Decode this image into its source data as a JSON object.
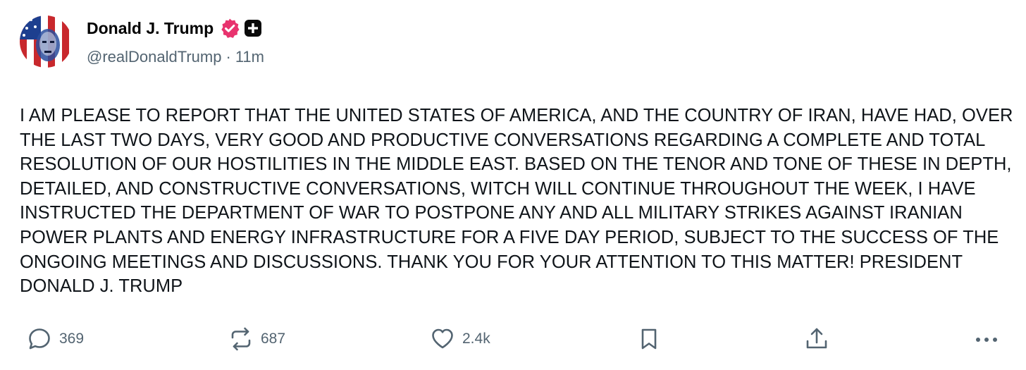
{
  "post": {
    "author_name": "Donald J. Trump",
    "handle": "@realDonaldTrump",
    "separator": "·",
    "time_ago": "11m",
    "text": "I AM PLEASE TO REPORT THAT THE UNITED STATES OF AMERICA, AND THE COUNTRY OF IRAN, HAVE HAD, OVER THE LAST TWO DAYS, VERY GOOD AND PRODUCTIVE CONVERSATIONS REGARDING A COMPLETE AND TOTAL RESOLUTION OF OUR HOSTILITIES IN THE MIDDLE EAST. BASED ON THE TENOR AND TONE OF THESE IN DEPTH, DETAILED, AND CONSTRUCTIVE CONVERSATIONS, WITCH WILL CONTINUE THROUGHOUT THE WEEK, I HAVE INSTRUCTED THE DEPARTMENT OF WAR TO POSTPONE ANY AND ALL MILITARY STRIKES AGAINST IRANIAN POWER PLANTS AND ENERGY INFRASTRUCTURE FOR A FIVE DAY PERIOD, SUBJECT TO THE SUCCESS OF THE ONGOING MEETINGS AND DISCUSSIONS. THANK YOU FOR YOUR ATTENTION TO THIS MATTER! PRESIDENT DONALD J. TRUMP"
  },
  "actions": {
    "replies": "369",
    "reposts": "687",
    "likes": "2.4k"
  },
  "icons": {
    "avatar": "avatar-flag-portrait",
    "verified": "verified-badge-icon",
    "plus": "plus-badge-icon",
    "reply": "reply-bubble-icon",
    "repost": "repost-arrows-icon",
    "like": "heart-icon",
    "bookmark": "bookmark-icon",
    "share": "share-upload-icon",
    "more": "more-dots-icon"
  },
  "colors": {
    "verified": "#e8336e",
    "text": "#0f1419",
    "muted": "#536471"
  }
}
